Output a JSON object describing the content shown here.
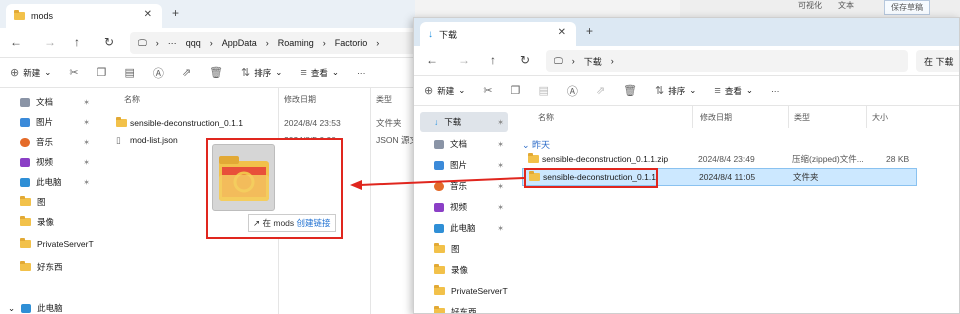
{
  "bg_toolbar": {
    "label1": "可视化",
    "label2": "文本",
    "save": "保存草稿"
  },
  "left_window": {
    "tab_title": "mods",
    "tab_close": "✕",
    "tab_new": "+",
    "address": {
      "more": "···",
      "crumbs": [
        "qqq",
        "AppData",
        "Roaming",
        "Factorio"
      ]
    },
    "toolbar": {
      "new_label": "新建"
    },
    "sidebar": [
      {
        "label": "文档"
      },
      {
        "label": "图片"
      },
      {
        "label": "音乐"
      },
      {
        "label": "视频"
      },
      {
        "label": "此电脑"
      },
      {
        "label": "图"
      },
      {
        "label": "录像"
      },
      {
        "label": "PrivateServerT"
      },
      {
        "label": "好东西"
      },
      {
        "label": "此电脑"
      }
    ],
    "columns": {
      "name": "名称",
      "date": "修改日期",
      "type": "类型"
    },
    "files": [
      {
        "name": "sensible-deconstruction_0.1.1",
        "date": "2024/8/4 23:53",
        "type": "文件夹"
      },
      {
        "name": "mod-list.json",
        "date": "2024/8/5 0:00",
        "type": "JSON 源文"
      }
    ]
  },
  "drag_tip": {
    "arrow": "↗",
    "prefix": "在 mods",
    "action": "创建链接"
  },
  "right_window": {
    "tab_title": "下载",
    "tab_close": "✕",
    "tab_new": "+",
    "window_controls": {
      "min": "—",
      "max": "☐",
      "close": "✕"
    },
    "address": {
      "crumb": "下载",
      "search_placeholder": "在 下载"
    },
    "toolbar": {
      "new_label": "新建",
      "sort_label": "排序",
      "view_label": "查看",
      "more": "···"
    },
    "sidebar": [
      {
        "label": "下载"
      },
      {
        "label": "文档"
      },
      {
        "label": "图片"
      },
      {
        "label": "音乐"
      },
      {
        "label": "视频"
      },
      {
        "label": "此电脑"
      },
      {
        "label": "图"
      },
      {
        "label": "录像"
      },
      {
        "label": "PrivateServerT"
      },
      {
        "label": "好东西"
      }
    ],
    "columns": {
      "name": "名称",
      "date": "修改日期",
      "type": "类型",
      "size": "大小"
    },
    "group": "昨天",
    "files": [
      {
        "name": "sensible-deconstruction_0.1.1.zip",
        "date": "2024/8/4 23:49",
        "type": "压缩(zipped)文件...",
        "size": "28 KB"
      },
      {
        "name": "sensible-deconstruction_0.1.1",
        "date": "2024/8/4 11:05",
        "type": "文件夹",
        "size": ""
      }
    ]
  },
  "left_toolbar_extra": {
    "sort_label": "排序",
    "view_label": "查看",
    "more": "···"
  },
  "colors": {
    "highlight": "#e0261e",
    "selection": "#cce8ff",
    "link": "#1d6fd1"
  }
}
